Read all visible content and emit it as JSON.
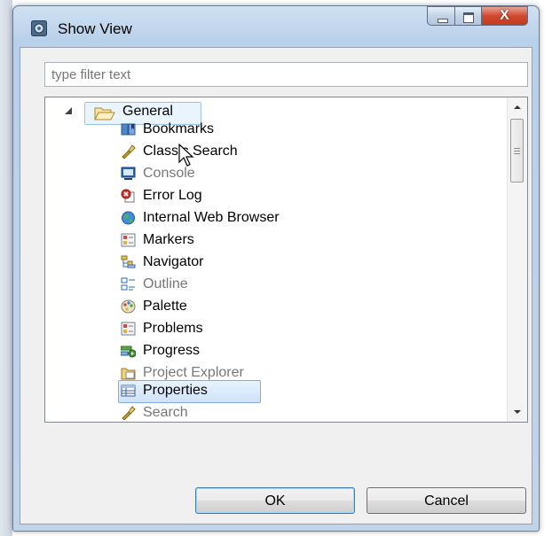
{
  "window": {
    "title": "Show View",
    "icon": "view-gear-icon",
    "controls": [
      "minimize-icon",
      "maximize-icon",
      "close-icon"
    ],
    "close_glyph": "X"
  },
  "filter": {
    "placeholder": "type filter text",
    "value": ""
  },
  "tree": {
    "category": {
      "label": "General",
      "icon": "folder-open-icon",
      "expanded": true
    },
    "items": [
      {
        "label": "Bookmarks",
        "icon": "bookmarks-icon",
        "enabled": true
      },
      {
        "label": "Classic Search",
        "icon": "search-flashlight-icon",
        "enabled": true
      },
      {
        "label": "Console",
        "icon": "console-icon",
        "enabled": false
      },
      {
        "label": "Error Log",
        "icon": "error-log-icon",
        "enabled": true
      },
      {
        "label": "Internal Web Browser",
        "icon": "globe-icon",
        "enabled": true
      },
      {
        "label": "Markers",
        "icon": "markers-icon",
        "enabled": true
      },
      {
        "label": "Navigator",
        "icon": "navigator-icon",
        "enabled": true
      },
      {
        "label": "Outline",
        "icon": "outline-icon",
        "enabled": false
      },
      {
        "label": "Palette",
        "icon": "palette-icon",
        "enabled": true
      },
      {
        "label": "Problems",
        "icon": "problems-icon",
        "enabled": true
      },
      {
        "label": "Progress",
        "icon": "progress-icon",
        "enabled": true
      },
      {
        "label": "Project Explorer",
        "icon": "project-explorer-icon",
        "enabled": false
      },
      {
        "label": "Properties",
        "icon": "properties-icon",
        "enabled": true,
        "selected": true
      },
      {
        "label": "Search",
        "icon": "search-flashlight-icon",
        "enabled": false
      }
    ]
  },
  "buttons": {
    "ok": "OK",
    "cancel": "Cancel"
  }
}
